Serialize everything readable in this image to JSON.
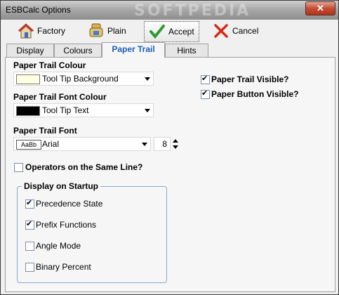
{
  "window": {
    "title": "ESBCalc Options",
    "watermark": "SOFTPEDIA",
    "close": "✕"
  },
  "toolbar": {
    "factory_label": "Factory",
    "plain_label": "Plain",
    "accept_label": "Accept",
    "cancel_label": "Cancel"
  },
  "tabs": [
    "Display",
    "Colours",
    "Paper Trail",
    "Hints"
  ],
  "active_tab": "Paper Trail",
  "paper_trail": {
    "colour_label": "Paper Trail Colour",
    "colour_value": "Tool Tip Background",
    "colour_swatch": "#ffffe1",
    "font_colour_label": "Paper Trail Font  Colour",
    "font_colour_value": "Tool Tip Text",
    "font_colour_swatch": "#000000",
    "font_label": "Paper Trail Font",
    "font_preview": "AaBb",
    "font_value": "Arial",
    "font_size": "8",
    "operators_same_line": {
      "label": "Operators on the Same Line?",
      "checked": false
    },
    "visible": {
      "label": "Paper Trail Visible?",
      "checked": true
    },
    "button_visible": {
      "label": "Paper Button Visible?",
      "checked": true
    }
  },
  "startup": {
    "title": "Display on Startup",
    "items": [
      {
        "label": "Precedence State",
        "checked": true
      },
      {
        "label": "Prefix Functions",
        "checked": true
      },
      {
        "label": "Angle Mode",
        "checked": false
      },
      {
        "label": "Binary Percent",
        "checked": false
      }
    ]
  }
}
